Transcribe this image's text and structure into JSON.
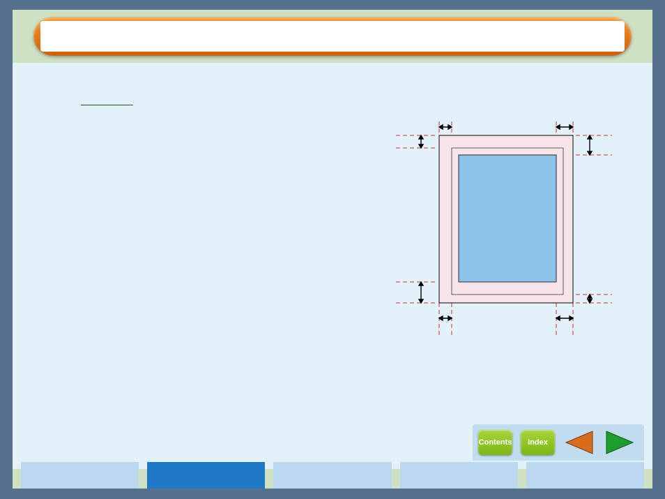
{
  "title": "",
  "nav": {
    "contents": "Contents",
    "index": "Index"
  },
  "tabs": [
    {
      "label": "",
      "active": false
    },
    {
      "label": "",
      "active": true
    },
    {
      "label": "",
      "active": false
    },
    {
      "label": "",
      "active": false
    },
    {
      "label": "",
      "active": false
    }
  ],
  "diagram": {
    "outer_color": "#f6e4e7",
    "inner_color": "#8dc3e8",
    "guide_color": "#d42a2a"
  }
}
